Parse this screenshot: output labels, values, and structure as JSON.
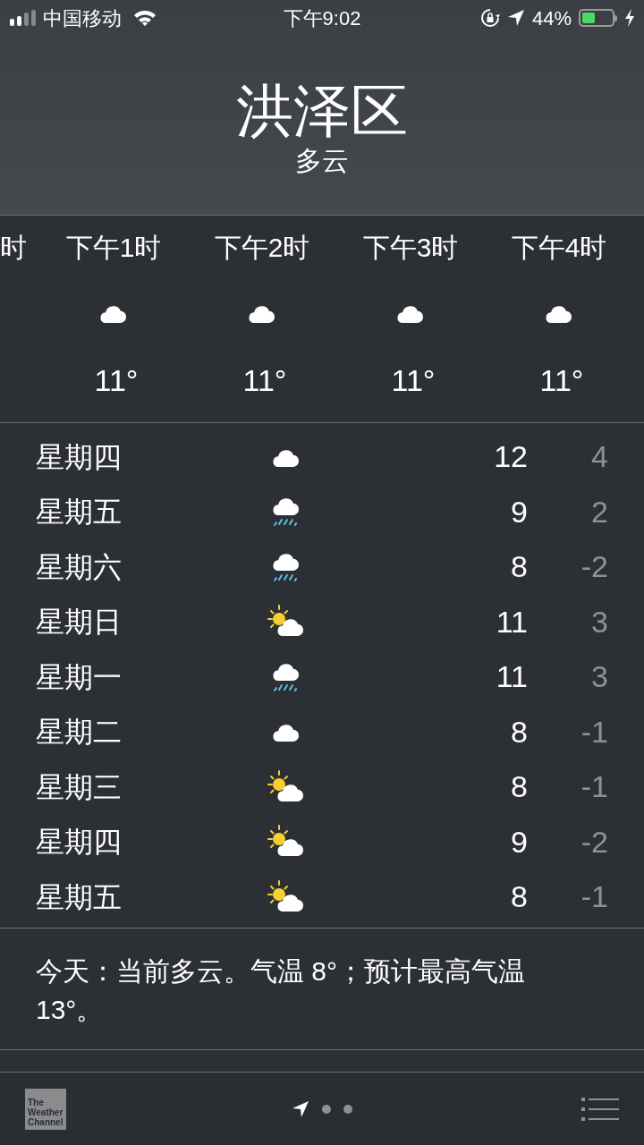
{
  "status_bar": {
    "carrier": "中国移动",
    "time": "下午9:02",
    "battery_text": "44%",
    "battery": {
      "level": 0.44
    },
    "charging": true
  },
  "location": {
    "city": "洪泽区",
    "condition": "多云"
  },
  "hourly": [
    {
      "time": "时"
    },
    {
      "time": "下午1时",
      "kind": "cloudy",
      "temp": "11°"
    },
    {
      "time": "下午2时",
      "kind": "cloudy",
      "temp": "11°"
    },
    {
      "time": "下午3时",
      "kind": "cloudy",
      "temp": "11°"
    },
    {
      "time": "下午4时",
      "kind": "cloudy",
      "temp": "11°"
    }
  ],
  "daily": [
    {
      "day": "星期四",
      "kind": "cloudy",
      "high": "12",
      "low": "4"
    },
    {
      "day": "星期五",
      "kind": "rain",
      "high": "9",
      "low": "2"
    },
    {
      "day": "星期六",
      "kind": "rain",
      "high": "8",
      "low": "-2"
    },
    {
      "day": "星期日",
      "kind": "partly_sunny",
      "high": "11",
      "low": "3"
    },
    {
      "day": "星期一",
      "kind": "rain",
      "high": "11",
      "low": "3"
    },
    {
      "day": "星期二",
      "kind": "cloudy",
      "high": "8",
      "low": "-1"
    },
    {
      "day": "星期三",
      "kind": "partly_sunny",
      "high": "8",
      "low": "-1"
    },
    {
      "day": "星期四",
      "kind": "partly_sunny",
      "high": "9",
      "low": "-2"
    },
    {
      "day": "星期五",
      "kind": "partly_sunny",
      "high": "8",
      "low": "-1"
    }
  ],
  "summary": "今天：当前多云。气温 8°；预计最高气温 13°。",
  "bottom_bar": {
    "logo": "The Weather Channel",
    "pages": [
      {
        "kind": "location",
        "selected": true
      },
      {
        "kind": "dot",
        "selected": false
      },
      {
        "kind": "dot",
        "selected": false
      }
    ]
  }
}
